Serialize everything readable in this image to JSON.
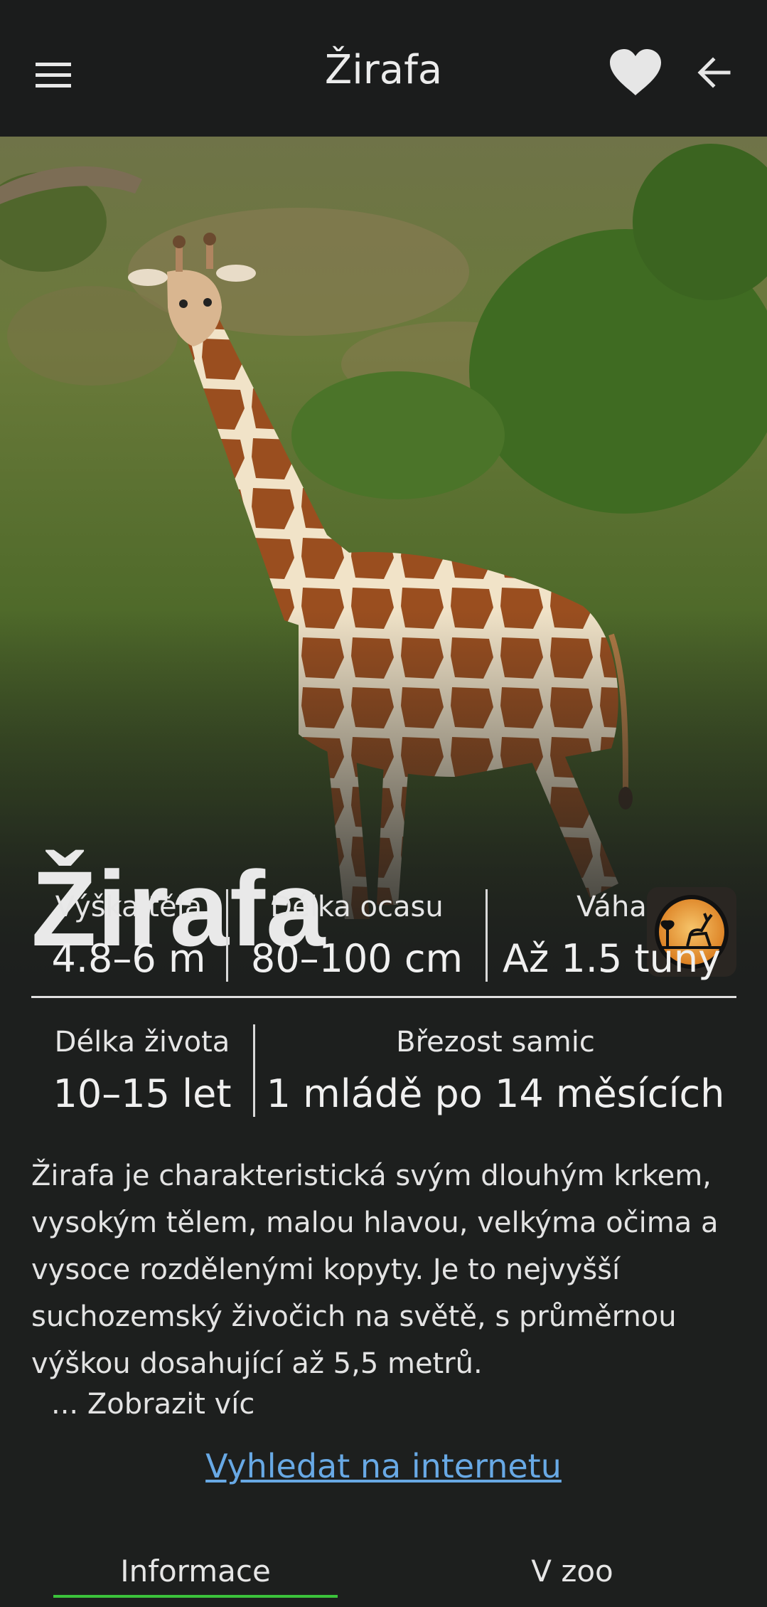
{
  "toolbar": {
    "title": "Žirafa",
    "menu_icon": "hamburger-menu-icon",
    "favorite_icon": "heart-icon",
    "back_icon": "arrow-left-icon"
  },
  "hero": {
    "title": "Žirafa",
    "badge_icon": "savanna-antelope-icon"
  },
  "stats_row1": [
    {
      "label": "Výška těla",
      "value": "4.8–6 m"
    },
    {
      "label": "Délka ocasu",
      "value": "80–100 cm"
    },
    {
      "label": "Váha",
      "value": "Až 1.5 tuny"
    }
  ],
  "stats_row2": [
    {
      "label": "Délka života",
      "value": "10–15 let"
    },
    {
      "label": "Březost samic",
      "value": "1 mládě po 14 měsících"
    }
  ],
  "description": {
    "lines": [
      "Žirafa je charakteristická svým dlouhým krkem,",
      "vysokým tělem, malou hlavou, velkýma očima a",
      "vysoce rozdělenými kopyty. Je to nejvyšší",
      "suchozemský živočich na světě, s průměrnou",
      "výškou dosahující až 5,5 metrů."
    ],
    "more_label": "... Zobrazit víc"
  },
  "search_link": "Vyhledat na internetu",
  "tabs": [
    {
      "label": "Informace",
      "active": true
    },
    {
      "label": "V zoo",
      "active": false
    }
  ],
  "colors": {
    "background": "#1d1f1e",
    "accent": "#3bc23b",
    "link": "#68a9e5",
    "badge": "#e08a1e"
  }
}
